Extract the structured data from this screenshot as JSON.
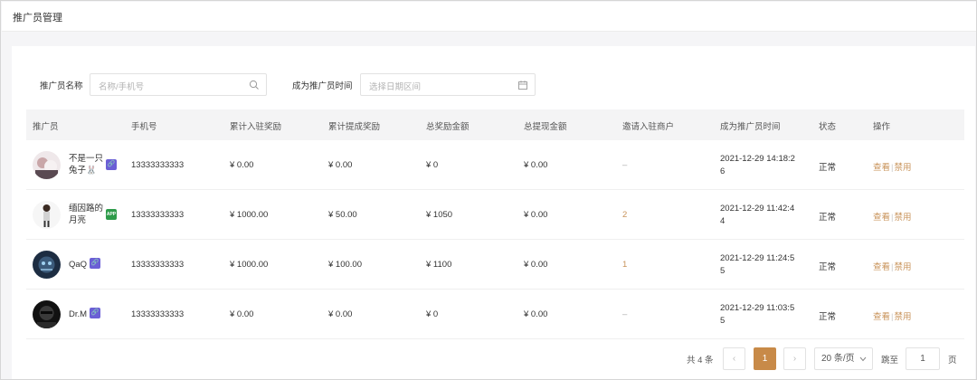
{
  "header": {
    "title": "推广员管理"
  },
  "filters": {
    "name_label": "推广员名称",
    "name_placeholder": "名称/手机号",
    "time_label": "成为推广员时间",
    "time_placeholder": "选择日期区间"
  },
  "table": {
    "columns": [
      "推广员",
      "手机号",
      "累计入驻奖励",
      "累计提成奖励",
      "总奖励金额",
      "总提现金额",
      "邀请入驻商户",
      "成为推广员时间",
      "状态",
      "操作"
    ],
    "rows": [
      {
        "name_line1": "不是一只",
        "name_line2": "兔子🐰",
        "badge": "link",
        "phone": "13333333333",
        "join_reward": "¥ 0.00",
        "commission": "¥ 0.00",
        "total_reward": "¥ 0",
        "withdrawn": "¥ 0.00",
        "invited": "–",
        "time_line1": "2021-12-29 14:18:2",
        "time_line2": "6",
        "status": "正常",
        "view": "查看",
        "disable": "禁用"
      },
      {
        "name_line1": "缅因路的",
        "name_line2": "月亮",
        "badge": "APP",
        "phone": "13333333333",
        "join_reward": "¥ 1000.00",
        "commission": "¥ 50.00",
        "total_reward": "¥ 1050",
        "withdrawn": "¥ 0.00",
        "invited": "2",
        "time_line1": "2021-12-29 11:42:4",
        "time_line2": "4",
        "status": "正常",
        "view": "查看",
        "disable": "禁用"
      },
      {
        "name_line1": "QaQ",
        "name_line2": "",
        "badge": "link",
        "phone": "13333333333",
        "join_reward": "¥ 1000.00",
        "commission": "¥ 100.00",
        "total_reward": "¥ 1100",
        "withdrawn": "¥ 0.00",
        "invited": "1",
        "time_line1": "2021-12-29 11:24:5",
        "time_line2": "5",
        "status": "正常",
        "view": "查看",
        "disable": "禁用"
      },
      {
        "name_line1": "Dr.M",
        "name_line2": "",
        "badge": "link",
        "phone": "13333333333",
        "join_reward": "¥ 0.00",
        "commission": "¥ 0.00",
        "total_reward": "¥ 0",
        "withdrawn": "¥ 0.00",
        "invited": "–",
        "time_line1": "2021-12-29 11:03:5",
        "time_line2": "5",
        "status": "正常",
        "view": "查看",
        "disable": "禁用"
      }
    ]
  },
  "pagination": {
    "total": "共 4 条",
    "prev": "‹",
    "current": "1",
    "next": "›",
    "page_size": "20 条/页",
    "goto_label": "跳至",
    "goto_value": "1",
    "page_suffix": "页"
  },
  "colors": {
    "accent": "#c88a48",
    "link_badge": "#6b5fd6",
    "app_badge": "#2e9b4a"
  }
}
